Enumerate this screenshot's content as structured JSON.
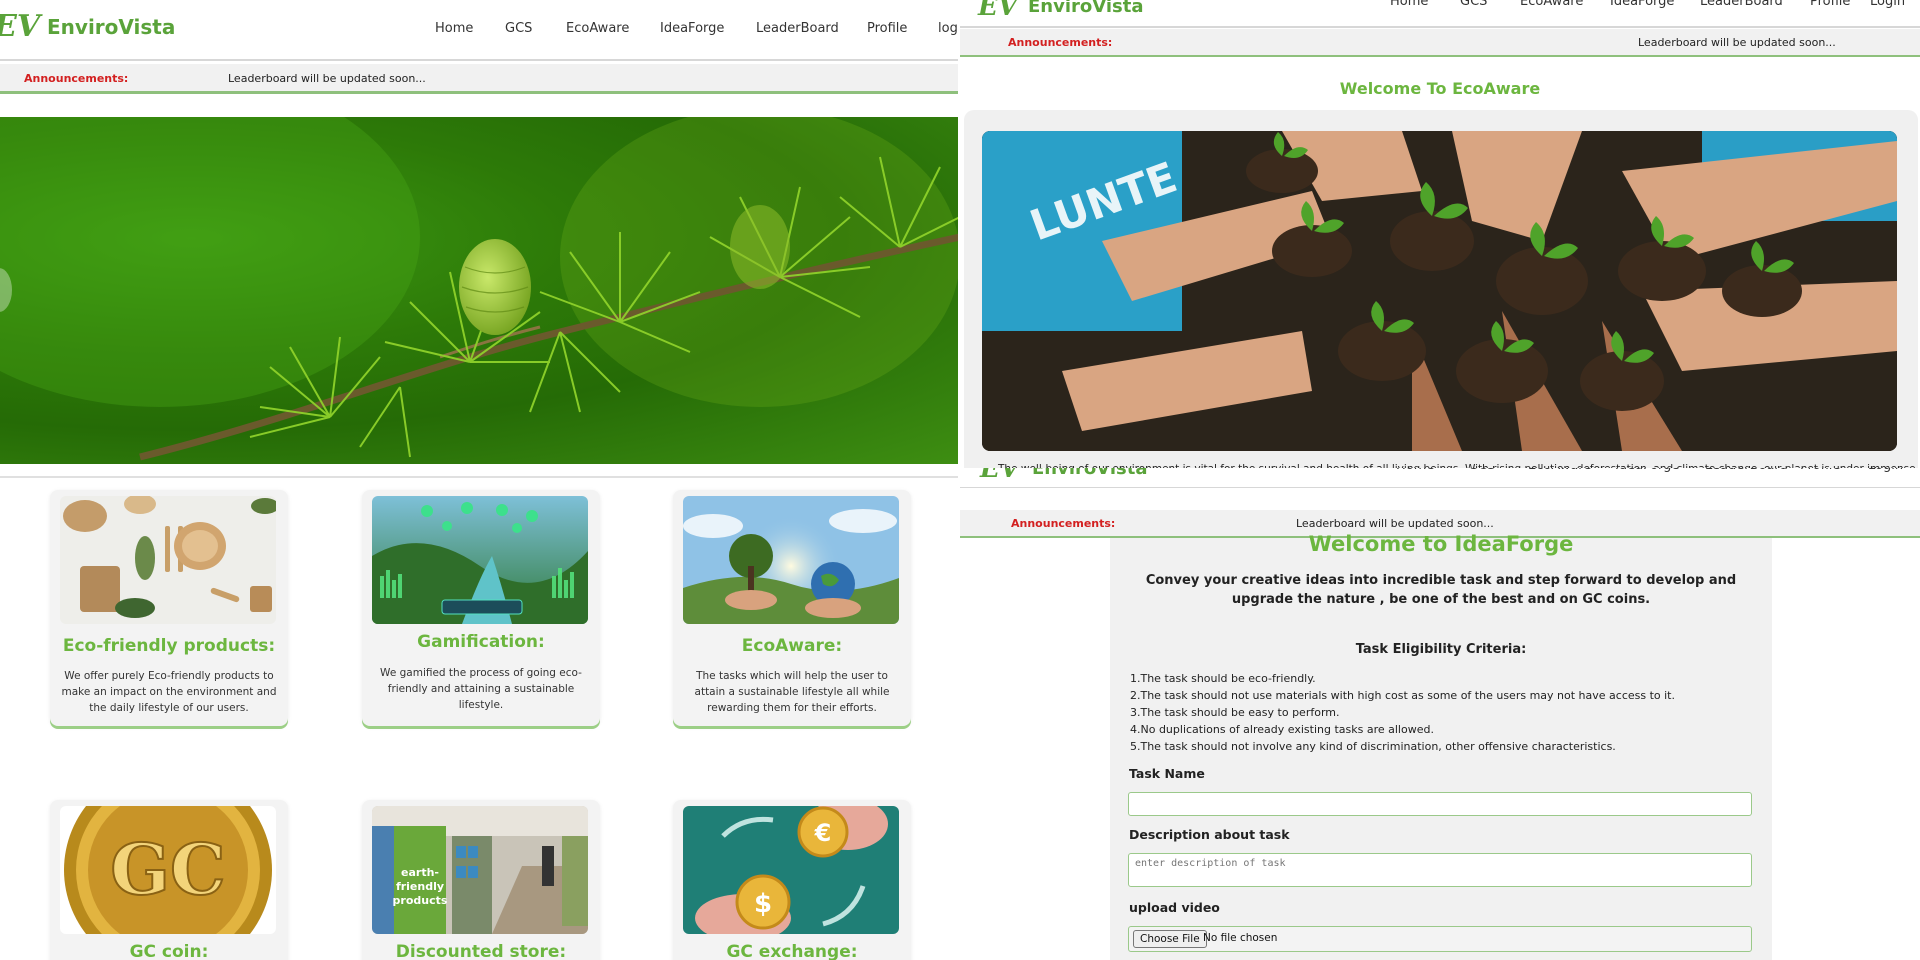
{
  "brand": {
    "logo_mark": "EV",
    "name": "EnviroVista",
    "color": "#5aa33a",
    "accent": "#6cb63f"
  },
  "nav": {
    "home": "Home",
    "gcs": "GCS",
    "ecoaware": "EcoAware",
    "ideaforge": "IdeaForge",
    "leaderboard": "LeaderBoard",
    "profile": "Profile",
    "login_partial": "log",
    "login": "Login"
  },
  "announcement": {
    "label": "Announcements:",
    "text": "Leaderboard will be updated soon...",
    "label_color": "#d32020"
  },
  "cards": [
    {
      "title": "Eco-friendly products:",
      "desc": "We offer purely Eco-friendly products to make an impact on the environment and the daily lifestyle of our users.",
      "image": "eco-products"
    },
    {
      "title": "Gamification:",
      "desc": "We gamified the process of going eco-friendly and attaining a sustainable lifestyle.",
      "image": "gamification"
    },
    {
      "title": "EcoAware:",
      "desc": "The tasks which will help the user to attain a sustainable lifestyle all while rewarding them for their efforts.",
      "image": "ecoaware"
    },
    {
      "title": "GC coin:",
      "image": "gc-coin"
    },
    {
      "title": "Discounted store:",
      "image": "store"
    },
    {
      "title": "GC exchange:",
      "image": "exchange"
    }
  ],
  "ecoaware": {
    "title": "Welcome To EcoAware",
    "paragraph": "The well-being of our environment is vital for the survival and health of all living beings. With rising pollution, deforestation, and climate change, our planet is under immense"
  },
  "ideaforge": {
    "title": "Welcome to IdeaForge",
    "subtitle": "Convey your creative ideas into incredible task and step forward to develop and upgrade the nature , be one of the best and on GC coins.",
    "criteria_title": "Task Eligibility Criteria:",
    "criteria": [
      "1.The task should be eco-friendly.",
      "2.The task should not use materials with high cost as some of the users may not have access to it.",
      "3.The task should be easy to perform.",
      "4.No duplications of already existing tasks are allowed.",
      "5.The task should not involve any kind of discrimination, other offensive characteristics."
    ],
    "task_name_label": "Task Name",
    "description_label": "Description about task",
    "description_placeholder": "enter description of task",
    "upload_label": "upload video",
    "choose_file": "Choose File",
    "no_file": "No file chosen"
  }
}
